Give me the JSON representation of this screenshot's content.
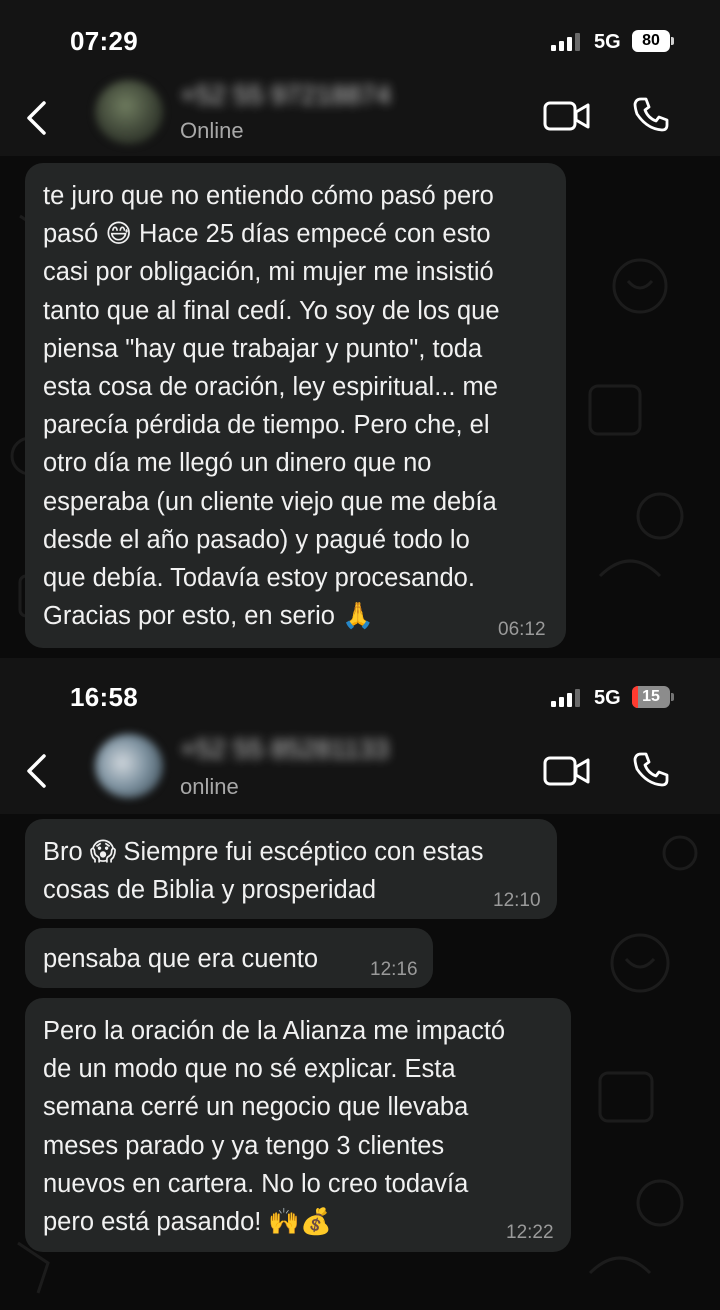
{
  "screenshots": [
    {
      "status": {
        "time": "07:29",
        "network": "5G",
        "battery": "80"
      },
      "chat": {
        "contact": "+52 55 97218874",
        "presence": "Online"
      },
      "messages": [
        {
          "text": "te juro que no entiendo cómo pasó pero\npasó 😅 Hace 25 días empecé con esto\ncasi por obligación, mi mujer me insistió\ntanto que al final cedí. Yo soy de los que\npiensa \"hay que trabajar y punto\", toda\nesta cosa de oración, ley espiritual... me\nparecía pérdida de tiempo. Pero che, el\notro día me llegó un dinero que no\nesperaba (un cliente viejo que me debía\ndesde el año pasado) y pagué todo lo\nque debía. Todavía estoy procesando.\nGracias por esto, en serio 🙏",
          "time": "06:12"
        }
      ]
    },
    {
      "status": {
        "time": "16:58",
        "network": "5G",
        "battery": "15"
      },
      "chat": {
        "contact": "+52 55 85281133",
        "presence": "online"
      },
      "messages": [
        {
          "text": "Bro 😱 Siempre fui escéptico con estas\ncosas de Biblia y prosperidad",
          "time": "12:10"
        },
        {
          "text": "pensaba que era cuento",
          "time": "12:16"
        },
        {
          "text": "Pero la oración de la Alianza me impactó\nde un modo que no sé explicar. Esta\nsemana cerré un negocio que llevaba\nmeses parado y ya tengo 3 clientes\nnuevos en cartera. No lo creo todavía\npero está pasando! 🙌💰",
          "time": "12:22"
        }
      ]
    }
  ],
  "colors": {
    "background": "#0b0b0b",
    "header": "#141414",
    "bubble": "#242626",
    "text": "#f1f1f1",
    "timestamp": "#9a9a9a",
    "battery_low": "#ff3b30"
  },
  "icons": [
    "back-chevron-icon",
    "video-call-icon",
    "phone-call-icon",
    "signal-icon",
    "battery-icon"
  ]
}
